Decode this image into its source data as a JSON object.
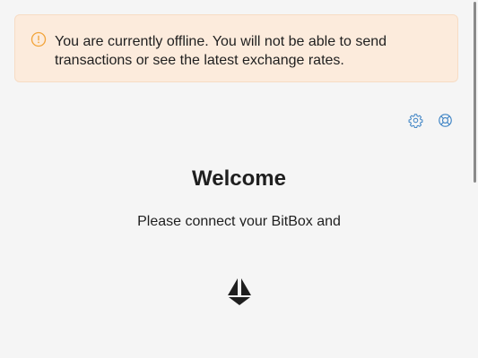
{
  "banner": {
    "icon": "warning-circle-icon",
    "message": "You are currently offline. You will not be able to send transactions or see the latest exchange rates.",
    "background": "#fcebdc",
    "accent": "#f2a43a"
  },
  "toolbar": {
    "settings_icon": "gear-icon",
    "help_icon": "lifebuoy-icon",
    "icon_color": "#3b82c4"
  },
  "main": {
    "title": "Welcome",
    "subtitle": "Please connect your BitBox and"
  },
  "logo": {
    "icon": "bitbox-logo-icon"
  }
}
